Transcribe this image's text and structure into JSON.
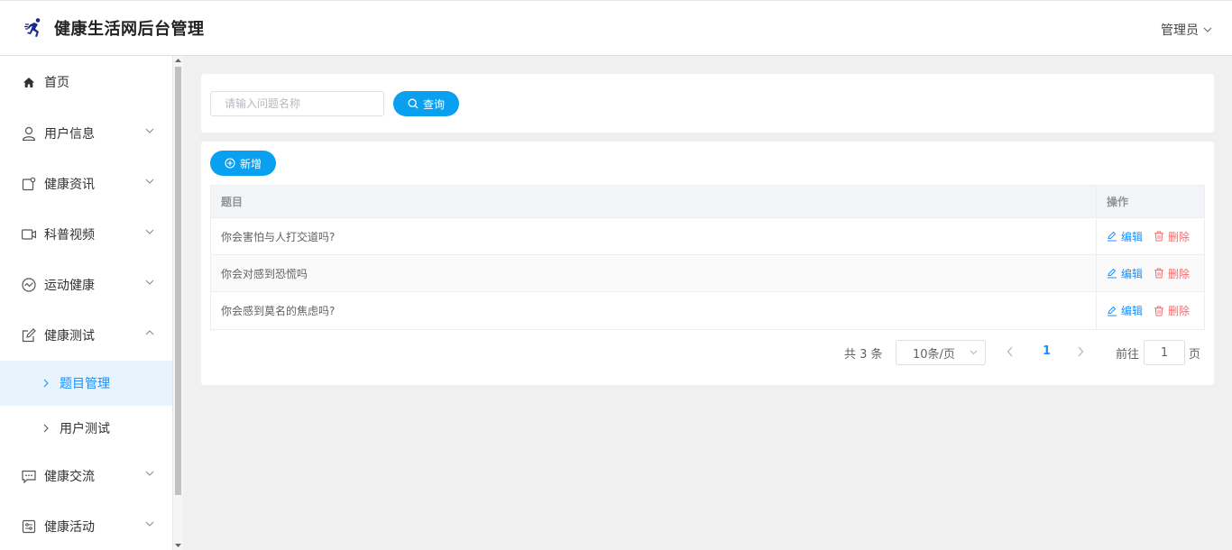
{
  "header": {
    "title": "健康生活网后台管理",
    "user": "管理员"
  },
  "sidebar": {
    "items": [
      {
        "label": "首页",
        "icon": "home-icon"
      },
      {
        "label": "用户信息",
        "icon": "user-icon"
      },
      {
        "label": "健康资讯",
        "icon": "news-icon"
      },
      {
        "label": "科普视频",
        "icon": "video-icon"
      },
      {
        "label": "运动健康",
        "icon": "sport-icon"
      },
      {
        "label": "健康测试",
        "icon": "edit-icon"
      },
      {
        "label": "健康交流",
        "icon": "chat-icon"
      },
      {
        "label": "健康活动",
        "icon": "activity-icon"
      }
    ],
    "sub_items": [
      {
        "label": "题目管理",
        "active": true
      },
      {
        "label": "用户测试",
        "active": false
      }
    ]
  },
  "search": {
    "placeholder": "请输入问题名称",
    "button": "查询"
  },
  "toolbar": {
    "add": "新增"
  },
  "table": {
    "columns": [
      "题目",
      "操作"
    ],
    "rows": [
      {
        "title": "你会害怕与人打交道吗?"
      },
      {
        "title": "你会对感到恐慌吗"
      },
      {
        "title": "你会感到莫名的焦虑吗?"
      }
    ],
    "edit_label": "编辑",
    "delete_label": "删除"
  },
  "pagination": {
    "total": "共 3 条",
    "page_size": "10条/页",
    "current": "1",
    "goto_label": "前往",
    "goto_value": "1",
    "page_suffix": "页"
  },
  "colors": {
    "primary": "#0aa0f0",
    "link": "#1890ff",
    "danger": "#f56c6c",
    "active_bg": "#e8f4fd"
  }
}
